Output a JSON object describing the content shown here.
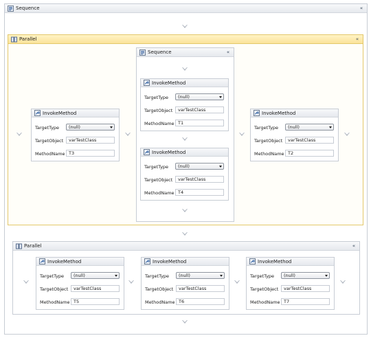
{
  "sequence": {
    "title": "Sequence",
    "collapse_glyph": "«"
  },
  "parallel1": {
    "title": "Parallel",
    "collapse_glyph": "«",
    "inner_sequence": {
      "title": "Sequence",
      "collapse_glyph": "«"
    }
  },
  "parallel2": {
    "title": "Parallel",
    "collapse_glyph": "«"
  },
  "labels": {
    "activity_title": "InvokeMethod",
    "target_type": "TargetType",
    "target_object": "TargetObject",
    "method_name": "MethodName"
  },
  "activities": {
    "t1": {
      "target_type": "(null)",
      "target_object": "varTestClass",
      "method_name": "T1"
    },
    "t2": {
      "target_type": "(null)",
      "target_object": "varTestClass",
      "method_name": "T2"
    },
    "t3": {
      "target_type": "(null)",
      "target_object": "varTestClass",
      "method_name": "T3"
    },
    "t4": {
      "target_type": "(null)",
      "target_object": "varTestClass",
      "method_name": "T4"
    },
    "t5": {
      "target_type": "(null)",
      "target_object": "varTestClass",
      "method_name": "T5"
    },
    "t6": {
      "target_type": "(null)",
      "target_object": "varTestClass",
      "method_name": "T6"
    },
    "t7": {
      "target_type": "(null)",
      "target_object": "varTestClass",
      "method_name": "T7"
    }
  },
  "icons": {
    "sequence": "sequence-icon",
    "parallel": "parallel-icon",
    "invoke": "invoke-method-icon",
    "collapse": "collapse-chevron-icon",
    "drop": "drop-target-arrow"
  },
  "colors": {
    "selected_border": "#e3c86a",
    "selected_header": "#fbe39b",
    "border": "#c7ccd4"
  }
}
